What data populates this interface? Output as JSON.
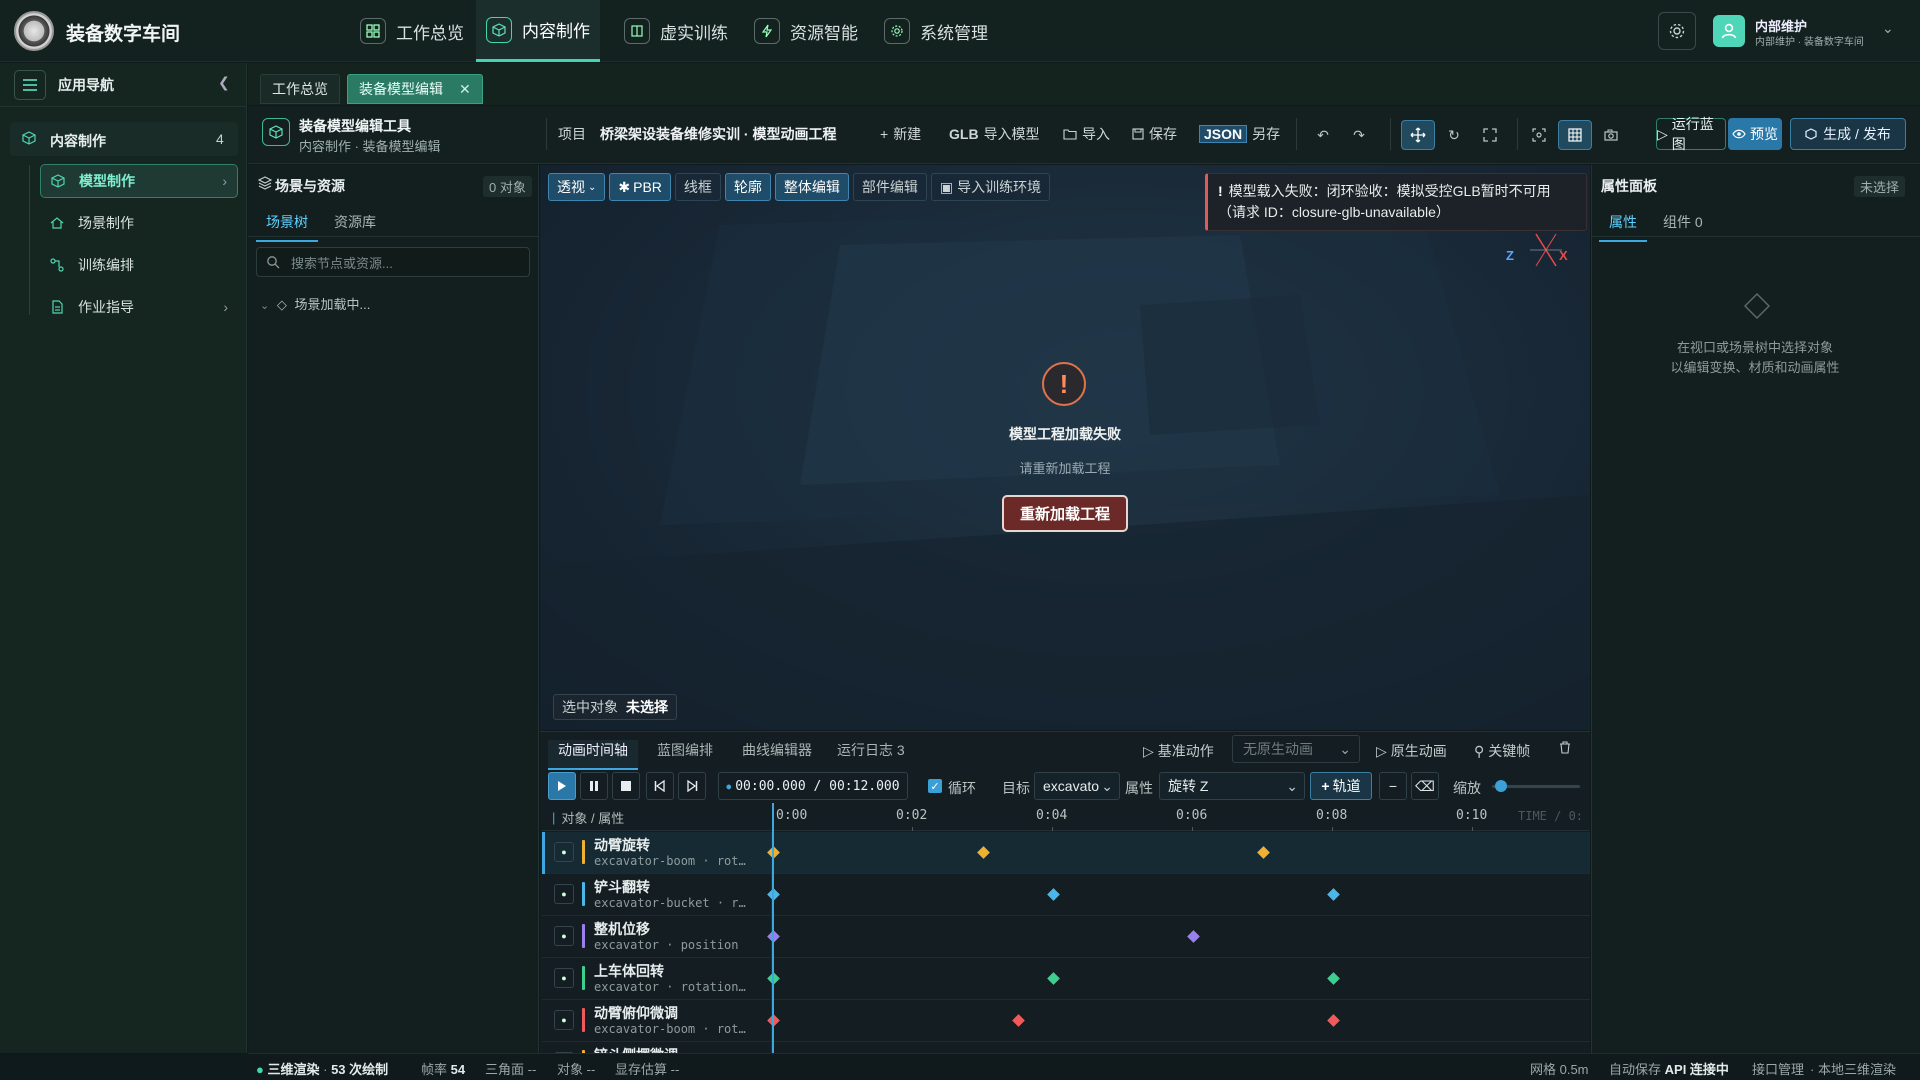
{
  "app": {
    "title": "装备数字车间"
  },
  "topnav": [
    {
      "label": "工作总览",
      "icon": "grid-icon"
    },
    {
      "label": "内容制作",
      "icon": "cube-icon",
      "active": true
    },
    {
      "label": "虚实训练",
      "icon": "book-icon"
    },
    {
      "label": "资源智能",
      "icon": "lightning-icon"
    },
    {
      "label": "系统管理",
      "icon": "gear-icon"
    }
  ],
  "user": {
    "name": "内部维护",
    "subtitle": "内部维护 · 装备数字车间"
  },
  "sidebar": {
    "title": "应用导航",
    "section": {
      "label": "内容制作",
      "count": "4"
    },
    "items": [
      {
        "label": "模型制作",
        "active": true
      },
      {
        "label": "场景制作"
      },
      {
        "label": "训练编排"
      },
      {
        "label": "作业指导"
      }
    ]
  },
  "doc_tabs": [
    {
      "label": "工作总览"
    },
    {
      "label": "装备模型编辑",
      "active": true
    }
  ],
  "tool": {
    "title": "装备模型编辑工具",
    "crumb": "内容制作 · 装备模型编辑",
    "project_label": "项目",
    "project_name": "桥梁架设装备维修实训 · 模型动画工程",
    "new_label": "新建",
    "glb_label": "GLB",
    "import_model_label": "导入模型",
    "import_label": "导入",
    "save_label": "保存",
    "json_label": "JSON",
    "saveas_label": "另存",
    "run_label": "运行蓝图",
    "preview_label": "预览",
    "publish_label": "生成 / 发布"
  },
  "left_panel": {
    "title": "场景与资源",
    "count": "0 对象",
    "tabs": [
      "场景树",
      "资源库"
    ],
    "search_placeholder": "搜索节点或资源...",
    "tree_item": "场景加载中..."
  },
  "viewport": {
    "toolbar": [
      "透视",
      "PBR",
      "线框",
      "轮廓",
      "整体编辑",
      "部件编辑",
      "导入训练环境"
    ],
    "error_toast": "模型载入失败：闭环验收：模拟受控GLB暂时不可用（请求 ID：closure-glb-unavailable）",
    "axis_z": "Z",
    "axis_x": "X",
    "error_title": "模型工程加载失败",
    "error_sub": "请重新加载工程",
    "reload_label": "重新加载工程",
    "selected_label": "选中对象",
    "selected_value": "未选择"
  },
  "right_panel": {
    "title": "属性面板",
    "status": "未选择",
    "tabs": [
      "属性",
      "组件 0"
    ],
    "empty_line1": "在视口或场景树中选择对象",
    "empty_line2": "以编辑变换、材质和动画属性"
  },
  "timeline": {
    "tabs": [
      "动画时间轴",
      "蓝图编排",
      "曲线编辑器",
      "运行日志 3"
    ],
    "base_action": "基准动作",
    "anim_select": "无原生动画",
    "native_anim": "原生动画",
    "keyframe": "关键帧",
    "time": "00:00.000 / 00:12.000",
    "loop": "循环",
    "target_label": "目标",
    "target_value": "excavato",
    "prop_label": "属性",
    "prop_value": "旋转 Z",
    "add_track": "轨道",
    "zoom_label": "缩放",
    "zoom_value": 0.1,
    "header_left": "对象 / 属性",
    "ticks": [
      "0:00",
      "0:02",
      "0:04",
      "0:06",
      "0:08",
      "0:10"
    ],
    "time_label": "TIME / 0:",
    "duration": 12,
    "playhead": 0,
    "tracks": [
      {
        "name": "动臂旋转",
        "sub": "excavator-boom · rot…",
        "color": "#f0b030",
        "keys": [
          0,
          3,
          7
        ]
      },
      {
        "name": "铲斗翻转",
        "sub": "excavator-bucket · r…",
        "color": "#4bb6e8",
        "keys": [
          0,
          4,
          8
        ]
      },
      {
        "name": "整机位移",
        "sub": "excavator · position",
        "color": "#9a7ff0",
        "keys": [
          0,
          6
        ]
      },
      {
        "name": "上车体回转",
        "sub": "excavator · rotation…",
        "color": "#3ccf8e",
        "keys": [
          0,
          4,
          8
        ]
      },
      {
        "name": "动臂俯仰微调",
        "sub": "excavator-boom · rot…",
        "color": "#f05a5a",
        "keys": [
          0,
          3.5,
          8
        ]
      },
      {
        "name": "铲斗侧摆微调",
        "sub": "",
        "color": "#f0b030",
        "keys": []
      }
    ]
  },
  "status": {
    "render": "三维渲染",
    "draws": "53 次绘制",
    "fps_label": "帧率",
    "fps": "54",
    "tris_label": "三角面",
    "tris": "--",
    "obj_label": "对象",
    "obj": "--",
    "mem_label": "显存估算",
    "mem": "--",
    "grid": "网格 0.5m",
    "autosave": "自动保存",
    "api": "API 连接中",
    "iface": "接口管理",
    "local": "本地三维渲染"
  }
}
